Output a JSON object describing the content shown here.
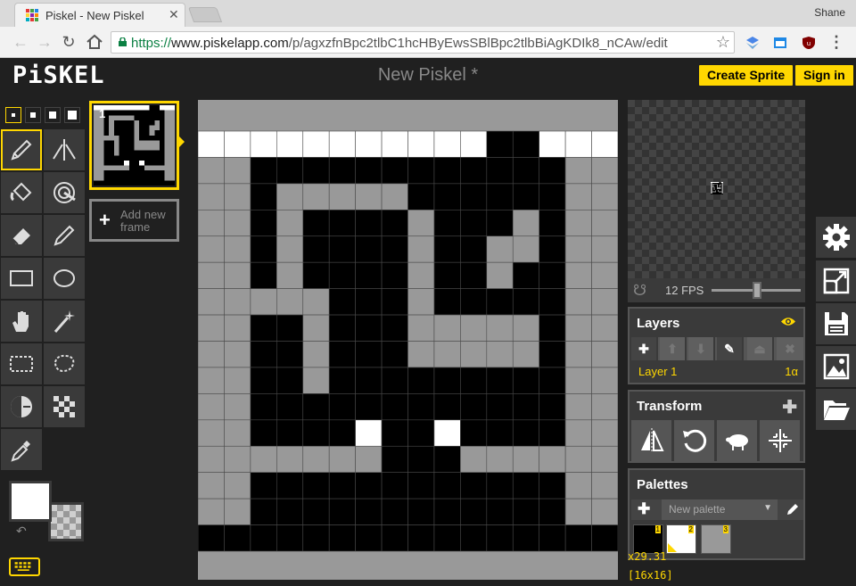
{
  "browser": {
    "tab_title": "Piskel - New Piskel",
    "tab_close": "✕",
    "profile_name": "Shane",
    "url_scheme": "https://",
    "url_host": "www.piskelapp.com",
    "url_path": "/p/agxzfnBpc2tlbC1hcHByEwsSBlBpc2tlbBiAgKDIk8_nCAw/edit"
  },
  "header": {
    "logo": "PiSKEL",
    "title": "New Piskel *",
    "create_label": "Create Sprite",
    "signin_label": "Sign in"
  },
  "frames": {
    "items": [
      {
        "number": "1"
      }
    ],
    "add_label": "Add new frame"
  },
  "colors": {
    "primary": "#ffffff",
    "secondary": "transparent",
    "accent": "#ffd700",
    "canvas_gray": "#999999"
  },
  "canvas": {
    "sprite_size": [
      16,
      16
    ],
    "palette": {
      "0": "#999999",
      "1": "#000000",
      "2": "#ffffff"
    },
    "rows": [
      "2222222222211222",
      "0011111111111100",
      "0010000011111100",
      "0010111101110100",
      "0010111101100100",
      "0010111101101100",
      "0000011101111100",
      "0011011100000100",
      "0011011100000100",
      "0011011111111100",
      "0011111111111100",
      "0011112112111100",
      "0000000111000000",
      "0011111111111100",
      "0011111111111100",
      "1111111111111111"
    ]
  },
  "preview": {
    "fps_label": "12 FPS",
    "fps": 12
  },
  "layers": {
    "title": "Layers",
    "items": [
      {
        "name": "Layer 1",
        "opacity": "1α"
      }
    ]
  },
  "transform": {
    "title": "Transform"
  },
  "palettes": {
    "title": "Palettes",
    "selected": "New palette",
    "swatches": [
      {
        "index": "1",
        "color": "#000000"
      },
      {
        "index": "2",
        "color": "#ffffff"
      },
      {
        "index": "3",
        "color": "#999999"
      }
    ]
  },
  "status": {
    "cursor": "x29.31",
    "size": "[16x16]"
  }
}
